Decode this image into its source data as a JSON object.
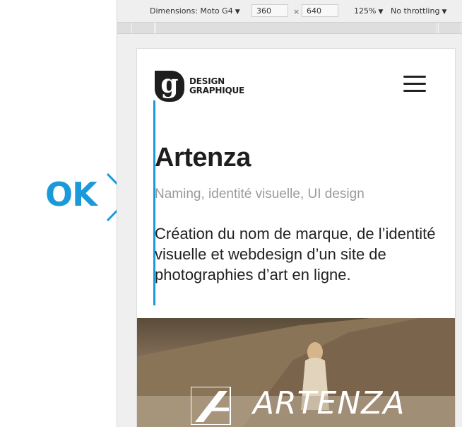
{
  "annotation": {
    "ok_label": "OK",
    "color": "#1a9ad9"
  },
  "toolbar": {
    "dimensions_label": "Dimensions: Moto G4",
    "width_value": "360",
    "times": "×",
    "height_value": "640",
    "zoom": "125%",
    "throttling": "No throttling"
  },
  "page": {
    "logo_letter": "g",
    "logo_line1": "DESIGN",
    "logo_line2": "GRAPHIQUE",
    "title": "Artenza",
    "subtitle": "Naming, identité visuelle, UI design",
    "description": "Création du nom de marque, de l’identité visuelle et webdesign d’un site de photographies d’art en ligne.",
    "hero_wordmark": "ARTENZA",
    "accent_color": "#1a9ad9"
  }
}
